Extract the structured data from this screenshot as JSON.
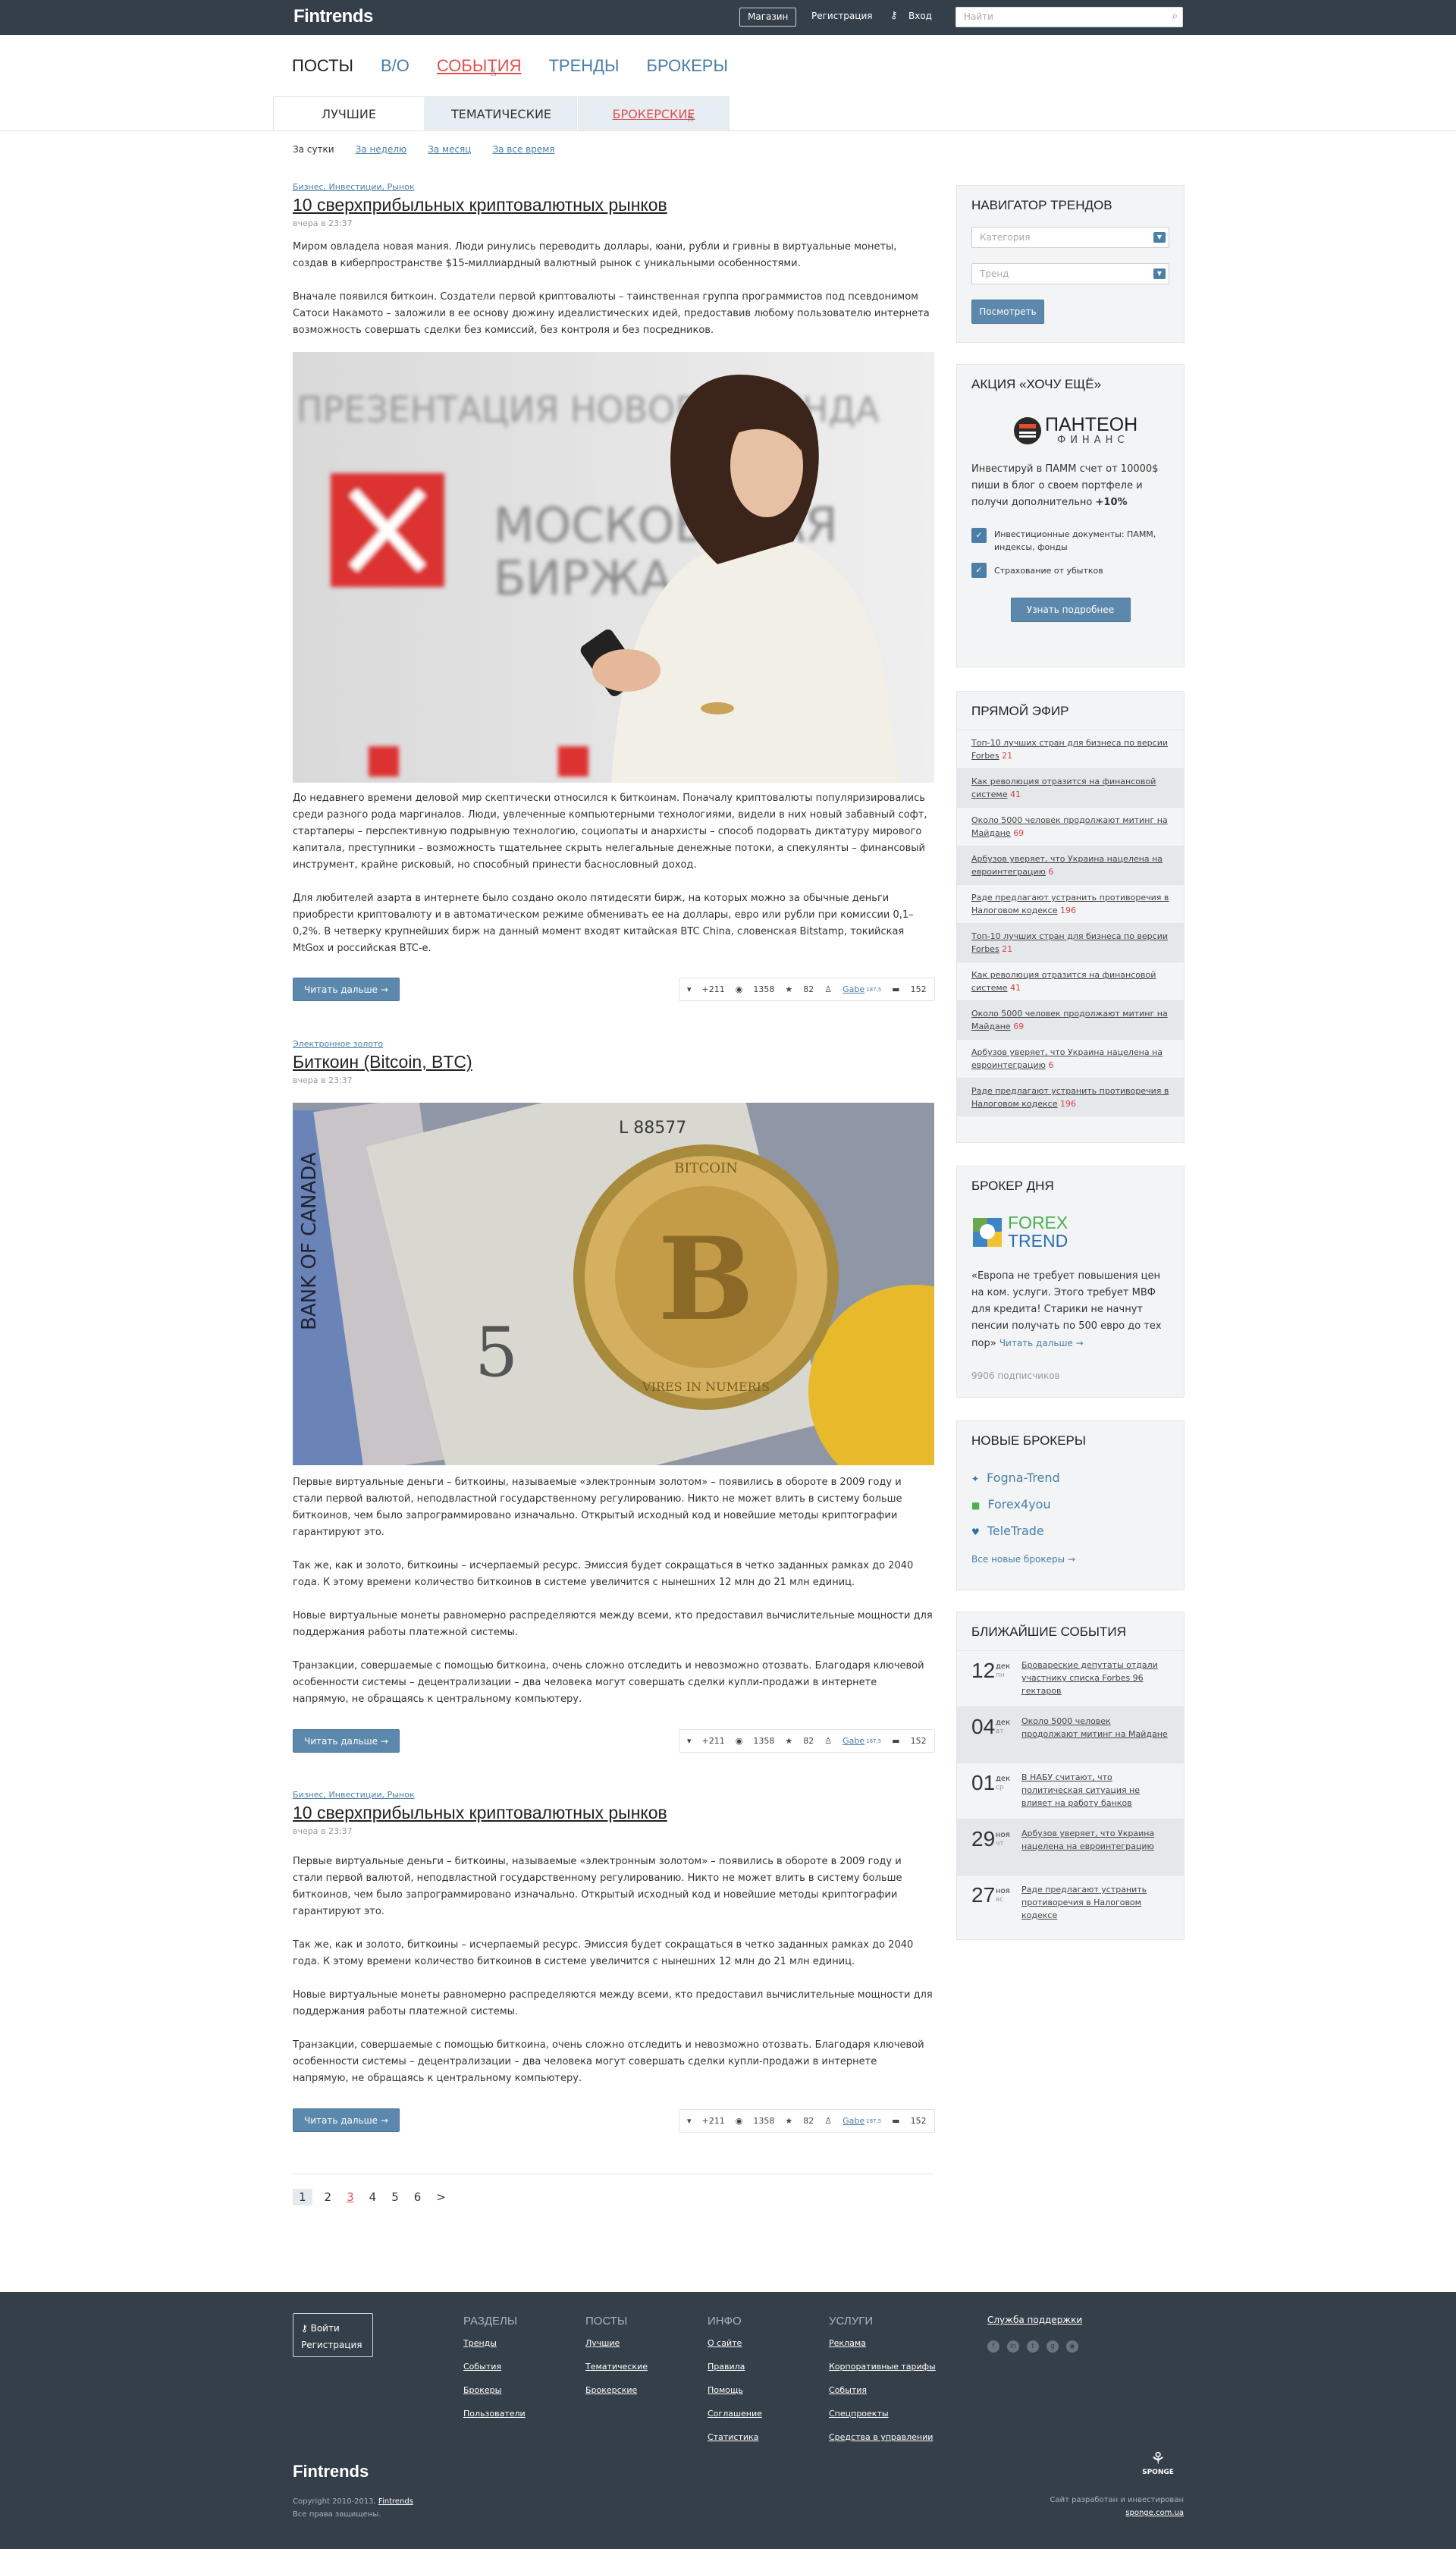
{
  "header": {
    "logo": "Fintrends",
    "shop_label": "Магазин",
    "register_label": "Регистрация",
    "login_label": "Вход",
    "search_placeholder": "Найти"
  },
  "main_nav": [
    "ПОСТЫ",
    "В/О",
    "СОБЫТИЯ",
    "ТРЕНДЫ",
    "БРОКЕРЫ"
  ],
  "sub_tabs": [
    "ЛУЧШИЕ",
    "ТЕМАТИЧЕСКИЕ",
    "БРОКЕРСКИЕ"
  ],
  "periods": [
    "За сутки",
    "За неделю",
    "За месяц",
    "За все время"
  ],
  "posts": [
    {
      "cats": "Бизнес, Инвестиции, Рынок",
      "title": "10 сверхприбыльных криптовалютных рынков",
      "date": "вчера в 23:37",
      "intro": [
        "Миром овладела новая мания. Люди ринулись переводить доллары, юани, рубли и гривны в виртуальные монеты, создав в киберпространстве $15-миллиардный валютный рынок с уникальными особенностями.",
        "Вначале появился биткоин. Создатели первой криптовалюты – таинственная группа программистов под псевдонимом Сатоси Накамото – заложили в ее основу дюжину идеалистических идей, предоставив любому пользователю интернета возможность совершать сделки без комиссий, без контроля и без посредников."
      ],
      "text": [
        "До недавнего времени деловой мир скептически относился к биткоинам. Поначалу криптовалюты популяризировались среди разного рода маргиналов. Люди, увлеченные компьютерными технологиями, видели в них новый забавный софт, стартаперы – перспективную подрывную технологию, социопаты и анархисты – способ подорвать диктатуру мирового капитала, преступники – возможность тщательнее скрыть нелегальные денежные потоки, а спекулянты – финансовый инструмент, крайне рисковый, но способный принести баснословный доход.",
        "Для любителей азарта в интернете было создано около пятидесяти бирж, на которых можно за обычные деньги приобрести криптовалюту и в автоматическом режиме обменивать ее на доллары, евро или рубли при комиссии 0,1–0,2%. В четверку крупнейших бирж на данный момент входят китайская BTC China, словенская Bitstamp, токийская MtGox и российская BTC-e."
      ],
      "image_caption": "ПРЕЗЕНТАЦИЯ НОВОГО БРЕНДА МОСКОВСКАЯ БИРЖА"
    },
    {
      "cats": "Электронное золото",
      "title": "Биткоин (Bitcoin, BTC)",
      "date": "вчера в 23:37",
      "text": [
        "Первые виртуальные деньги – биткоины, называемые «электронным золотом» – появились в обороте в 2009 году и стали первой валютой, неподвластной государственному регулированию. Никто не может влить в систему больше биткоинов, чем было запрограммировано изначально. Открытый исходный код и новейшие методы криптографии гарантируют это.",
        "Так же, как и золото, биткоины – исчерпаемый ресурс. Эмиссия будет сокращаться в четко заданных рамках до 2040 года. К этому времени количество биткоинов в системе увеличится с нынешних 12 млн до 21 млн единиц.",
        "Новые виртуальные монеты равномерно распределяются между всеми, кто предоставил вычислительные мощности для поддержания работы платежной системы.",
        "Транзакции, совершаемые с помощью биткоина, очень сложно отследить и невозможно отозвать. Благодаря ключевой особенности системы – децентрализации – два человека могут совершать сделки купли-продажи в интернете напрямую, не обращаясь к центральному компьютеру."
      ]
    },
    {
      "cats": "Бизнес, Инвестиции, Рынок",
      "title": "10 сверхприбыльных криптовалютных рынков",
      "date": "вчера в 23:37",
      "text": [
        "Первые виртуальные деньги – биткоины, называемые «электронным золотом» – появились в обороте в 2009 году и стали первой валютой, неподвластной государственному регулированию. Никто не может влить в систему больше биткоинов, чем было запрограммировано изначально. Открытый исходный код и новейшие методы криптографии гарантируют это.",
        "Так же, как и золото, биткоины – исчерпаемый ресурс. Эмиссия будет сокращаться в четко заданных рамках до 2040 года. К этому времени количество биткоинов в системе увеличится с нынешних 12 млн до 21 млн единиц.",
        "Новые виртуальные монеты равномерно распределяются между всеми, кто предоставил вычислительные мощности для поддержания работы платежной системы.",
        "Транзакции, совершаемые с помощью биткоина, очень сложно отследить и невозможно отозвать. Благодаря ключевой особенности системы – децентрализации – два человека могут совершать сделки купли-продажи в интернете напрямую, не обращаясь к центральному компьютеру."
      ]
    }
  ],
  "post_meta": {
    "read_more": "Читать дальше →",
    "votes": "+211",
    "views": "1358",
    "favs": "82",
    "author": "Gabe",
    "author_rank": "187,5",
    "comments": "152"
  },
  "pagination": [
    "1",
    "2",
    "3",
    "4",
    "5",
    "6",
    ">"
  ],
  "sidebar": {
    "navigator": {
      "title": "НАВИГАТОР ТРЕНДОВ",
      "category": "Категория",
      "trend": "Тренд",
      "button": "Посмотреть"
    },
    "promo": {
      "title": "АКЦИЯ «ХОЧУ ЕЩЁ»",
      "brand": "ПАНТЕОН",
      "brand_sub": "ФИНАНС",
      "text": "Инвестируй в ПАММ счет от 10000$ пиши в блог о своем портфеле и получи дополнительно",
      "bonus": "+10%",
      "check1": "Инвестиционные документы: ПАММ, индексы, фонды",
      "check2": "Страхование от убытков",
      "button": "Узнать подробнее"
    },
    "live": {
      "title": "ПРЯМОЙ ЭФИР",
      "items": [
        {
          "text": "Топ-10 лучших стран для бизнеса по версии Forbes",
          "count": "21"
        },
        {
          "text": "Как революция отразится на финансовой системе",
          "count": "41"
        },
        {
          "text": "Около 5000 человек продолжают митинг на Майдане",
          "count": "69"
        },
        {
          "text": "Арбузов уверяет, что Украина нацелена на евроинтеграцию",
          "count": "6"
        },
        {
          "text": "Раде предлагают устранить противоречия в Налоговом кодексе",
          "count": "196"
        },
        {
          "text": "Топ-10 лучших стран для бизнеса по версии Forbes",
          "count": "21"
        },
        {
          "text": "Как революция отразится на финансовой системе",
          "count": "41"
        },
        {
          "text": "Около 5000 человек продолжают митинг на Майдане",
          "count": "69"
        },
        {
          "text": "Арбузов уверяет, что Украина нацелена на евроинтеграцию",
          "count": "6"
        },
        {
          "text": "Раде предлагают устранить противоречия в Налоговом кодексе",
          "count": "196"
        }
      ]
    },
    "broker": {
      "title": "БРОКЕР ДНЯ",
      "brand1": "FOREX",
      "brand2": "TREND",
      "text": "«Европа не требует повышения цен на ком. услуги. Этого требует МВФ для кредита! Старики не начнут пенсии получать по 500 евро до тех пор»",
      "more": "Читать дальше →",
      "subs": "9906 подписчиков"
    },
    "new_brokers": {
      "title": "НОВЫЕ БРОКЕРЫ",
      "items": [
        "Fogna-Trend",
        "Forex4you",
        "TeleTrade"
      ],
      "all": "Все новые брокеры →"
    },
    "events": {
      "title": "БЛИЖАЙШИЕ СОБЫТИЯ",
      "items": [
        {
          "day": "12",
          "mon": "дек",
          "wd": "пн",
          "text": "Бровареские депутаты отдали участнику списка Forbes 96 гектаров"
        },
        {
          "day": "04",
          "mon": "дек",
          "wd": "вт",
          "text": "Около 5000 человек продолжают митинг на Майдане"
        },
        {
          "day": "01",
          "mon": "дек",
          "wd": "ср",
          "text": "В НАБУ считают, что политическая ситуация не влияет на работу банков"
        },
        {
          "day": "29",
          "mon": "ноя",
          "wd": "чт",
          "text": "Арбузов уверяет, что Украина нацелена на евроинтеграцию"
        },
        {
          "day": "27",
          "mon": "ноя",
          "wd": "вс",
          "text": "Раде предлагают устранить противоречия в Налоговом кодексе"
        }
      ]
    }
  },
  "footer": {
    "login": "Войти",
    "register": "Регистрация",
    "cols": [
      {
        "title": "РАЗДЕЛЫ",
        "links": [
          "Тренды",
          "События",
          "Брокеры",
          "Пользователи"
        ]
      },
      {
        "title": "ПОСТЫ",
        "links": [
          "Лучшие",
          "Тематические",
          "Брокерские"
        ]
      },
      {
        "title": "ИНФО",
        "links": [
          "О сайте",
          "Правила",
          "Помощь",
          "Соглашение",
          "Статистика"
        ]
      },
      {
        "title": "УСЛУГИ",
        "links": [
          "Реклама",
          "Корпоративные тарифы",
          "События",
          "Спецпроекты",
          "Средства в управлении"
        ]
      }
    ],
    "support": "Служба поддержки",
    "logo": "Fintrends",
    "copyright": "Copyright 2010-2013,",
    "copyright_link": "Fintrends",
    "rights": "Все права защищены.",
    "dev_text": "Сайт разработан и инвестирован",
    "dev_link": "sponge.com.ua",
    "dev_brand": "SPONGE",
    "social": [
      "f-icon",
      "in-icon",
      "twitter-icon",
      "gplus-icon",
      "rss-icon"
    ]
  }
}
